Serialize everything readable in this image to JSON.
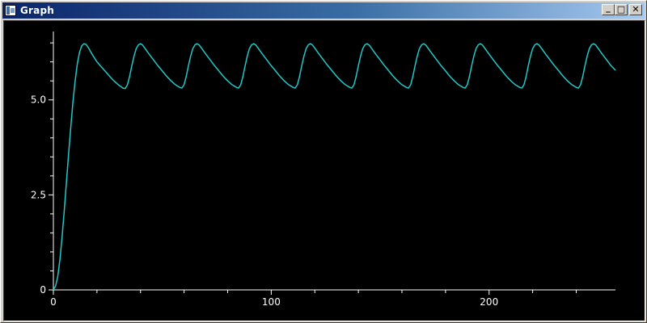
{
  "window": {
    "title": "Graph",
    "buttons": {
      "minimize": "_",
      "maximize": "□",
      "close": "✕"
    }
  },
  "chart_data": {
    "type": "line",
    "title": "",
    "xlabel": "",
    "ylabel": "",
    "xlim": [
      0,
      258
    ],
    "ylim": [
      0,
      6.8
    ],
    "x_ticks": [
      0,
      100,
      200
    ],
    "x_tick_labels": [
      "0",
      "100",
      "200"
    ],
    "y_ticks": [
      0,
      2.5,
      5.0
    ],
    "y_tick_labels": [
      "0",
      "2.5",
      "5.0"
    ],
    "grid": false,
    "background": "#000000",
    "axis_color": "#ffffff",
    "series": [
      {
        "color": "#20c8c8",
        "x": [
          0,
          1,
          2,
          3,
          4,
          5,
          6,
          7,
          8,
          9,
          10,
          11,
          12,
          13,
          14,
          15,
          16,
          17,
          18,
          20,
          22,
          24,
          26,
          28,
          30,
          32,
          33,
          34,
          35,
          36,
          37,
          38,
          39,
          40,
          41,
          42,
          44,
          46,
          48,
          50,
          52,
          54,
          56,
          58,
          59,
          60,
          61,
          62,
          63,
          64,
          65,
          66,
          67,
          68,
          70,
          72,
          74,
          76,
          78,
          80,
          82,
          84,
          85,
          86,
          87,
          88,
          89,
          90,
          91,
          92,
          93,
          94,
          96,
          98,
          100,
          102,
          104,
          106,
          108,
          110,
          111,
          112,
          113,
          114,
          115,
          116,
          117,
          118,
          119,
          120,
          122,
          124,
          126,
          128,
          130,
          132,
          134,
          136,
          137,
          138,
          139,
          140,
          141,
          142,
          143,
          144,
          145,
          146,
          148,
          150,
          152,
          154,
          156,
          158,
          160,
          162,
          163,
          164,
          165,
          166,
          167,
          168,
          169,
          170,
          171,
          172,
          174,
          176,
          178,
          180,
          182,
          184,
          186,
          188,
          189,
          190,
          191,
          192,
          193,
          194,
          195,
          196,
          197,
          198,
          200,
          202,
          204,
          206,
          208,
          210,
          212,
          214,
          215,
          216,
          217,
          218,
          219,
          220,
          221,
          222,
          223,
          224,
          226,
          228,
          230,
          232,
          234,
          236,
          238,
          240,
          241,
          242,
          243,
          244,
          245,
          246,
          247,
          248,
          249,
          250,
          252,
          254,
          256,
          258
        ],
        "values": [
          0,
          0.1,
          0.35,
          0.8,
          1.4,
          2.1,
          2.85,
          3.6,
          4.3,
          4.95,
          5.5,
          5.95,
          6.25,
          6.42,
          6.48,
          6.46,
          6.38,
          6.28,
          6.18,
          6.0,
          5.87,
          5.74,
          5.61,
          5.49,
          5.39,
          5.31,
          5.3,
          5.4,
          5.62,
          5.9,
          6.15,
          6.35,
          6.45,
          6.48,
          6.44,
          6.36,
          6.2,
          6.05,
          5.9,
          5.76,
          5.62,
          5.5,
          5.4,
          5.33,
          5.31,
          5.4,
          5.62,
          5.9,
          6.15,
          6.35,
          6.45,
          6.48,
          6.44,
          6.36,
          6.2,
          6.05,
          5.9,
          5.76,
          5.62,
          5.5,
          5.4,
          5.33,
          5.31,
          5.4,
          5.62,
          5.9,
          6.15,
          6.35,
          6.45,
          6.48,
          6.44,
          6.36,
          6.2,
          6.05,
          5.9,
          5.76,
          5.62,
          5.5,
          5.4,
          5.33,
          5.31,
          5.4,
          5.62,
          5.9,
          6.15,
          6.35,
          6.45,
          6.48,
          6.44,
          6.36,
          6.2,
          6.05,
          5.9,
          5.76,
          5.62,
          5.5,
          5.4,
          5.33,
          5.31,
          5.4,
          5.62,
          5.9,
          6.15,
          6.35,
          6.45,
          6.48,
          6.44,
          6.36,
          6.2,
          6.05,
          5.9,
          5.76,
          5.62,
          5.5,
          5.4,
          5.33,
          5.31,
          5.4,
          5.62,
          5.9,
          6.15,
          6.35,
          6.45,
          6.48,
          6.44,
          6.36,
          6.2,
          6.05,
          5.9,
          5.76,
          5.62,
          5.5,
          5.4,
          5.33,
          5.31,
          5.4,
          5.62,
          5.9,
          6.15,
          6.35,
          6.45,
          6.48,
          6.44,
          6.36,
          6.2,
          6.05,
          5.9,
          5.76,
          5.62,
          5.5,
          5.4,
          5.33,
          5.31,
          5.4,
          5.62,
          5.9,
          6.15,
          6.35,
          6.45,
          6.48,
          6.44,
          6.36,
          6.2,
          6.05,
          5.9,
          5.76,
          5.62,
          5.5,
          5.4,
          5.33,
          5.31,
          5.4,
          5.62,
          5.9,
          6.15,
          6.35,
          6.45,
          6.48,
          6.44,
          6.36,
          6.2,
          6.05,
          5.9,
          5.78
        ]
      }
    ]
  }
}
